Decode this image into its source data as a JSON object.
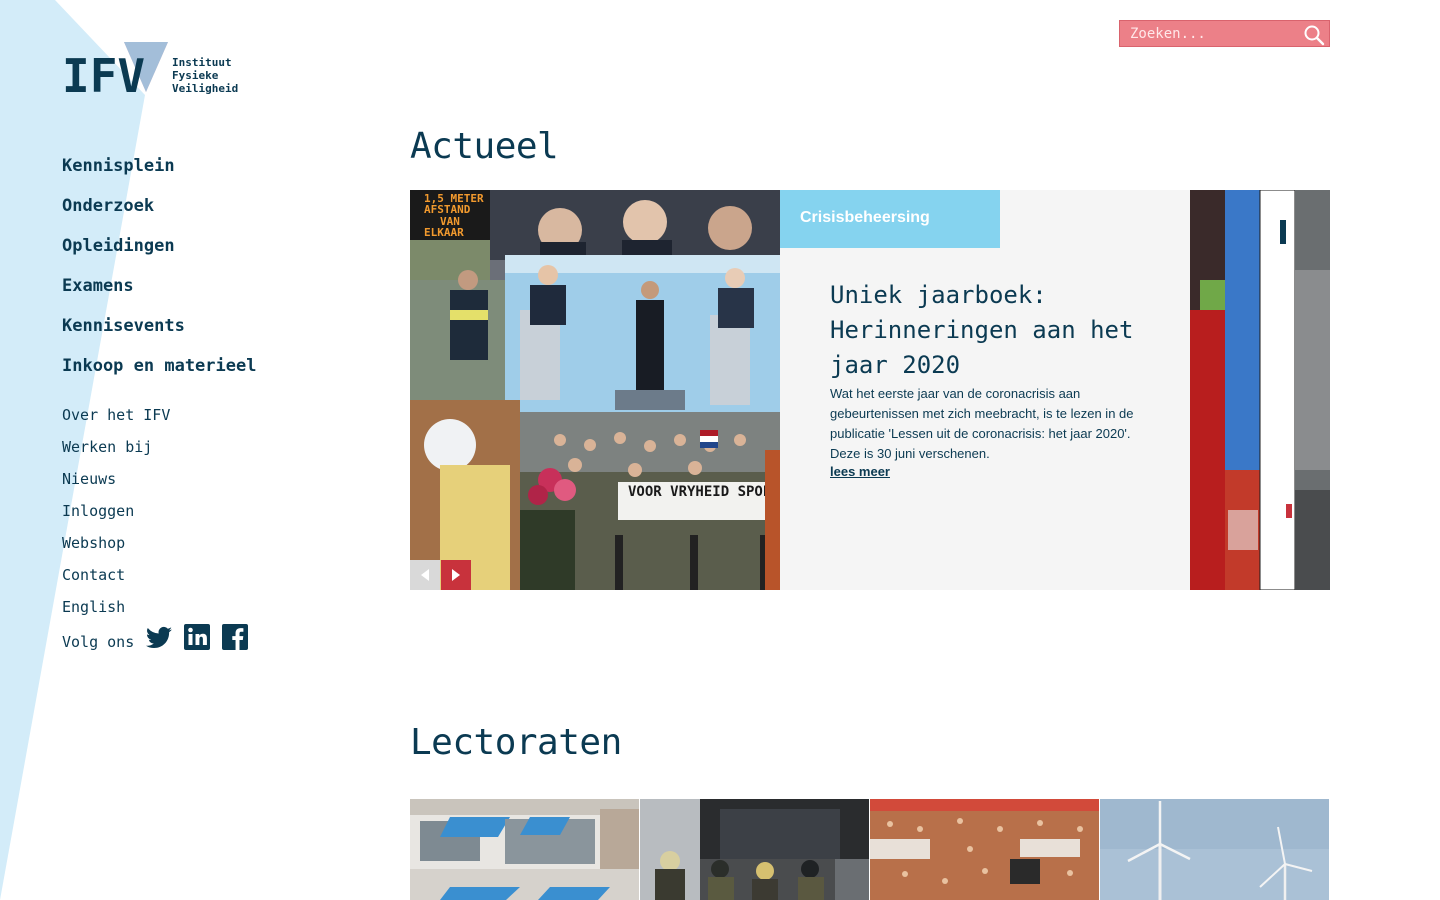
{
  "logo": {
    "letters": "IFV",
    "line1": "Instituut",
    "line2": "Fysieke",
    "line3": "Veiligheid"
  },
  "search": {
    "placeholder": "Zoeken..."
  },
  "main_nav": [
    {
      "label": "Kennisplein"
    },
    {
      "label": "Onderzoek"
    },
    {
      "label": "Opleidingen"
    },
    {
      "label": "Examens"
    },
    {
      "label": "Kennisevents"
    },
    {
      "label": "Inkoop en materieel"
    }
  ],
  "sub_nav": [
    {
      "label": "Over het IFV"
    },
    {
      "label": "Werken bij"
    },
    {
      "label": "Nieuws"
    },
    {
      "label": "Inloggen"
    },
    {
      "label": "Webshop"
    },
    {
      "label": "Contact"
    },
    {
      "label": "English"
    }
  ],
  "follow": {
    "label": "Volg ons",
    "icons": [
      "twitter-icon",
      "linkedin-icon",
      "facebook-icon"
    ]
  },
  "actueel": {
    "heading": "Actueel",
    "slide": {
      "category": "Crisisbeheersing",
      "title": "Uniek jaarboek: Herinneringen aan het jaar 2020",
      "text": "Wat het eerste jaar van de coronacrisis aan gebeurtenissen met zich meebracht, is te lezen in de publicatie 'Lessen uit de coronacrisis: het jaar 2020'. Deze is 30 juni verschenen.",
      "link": "lees meer",
      "photo_signs": {
        "sign_lines": [
          "1,5 METER",
          "AFSTAND",
          "VAN",
          "ELKAAR"
        ],
        "banner": "VOOR VRYHEID SPOE"
      }
    }
  },
  "lectoraten": {
    "heading": "Lectoraten"
  },
  "colors": {
    "navy": "#0b3a52",
    "light_blue": "#85d3ef",
    "search_pink": "#ec8088",
    "accent_red": "#c8323c",
    "stripe": "#d3ecf9"
  }
}
